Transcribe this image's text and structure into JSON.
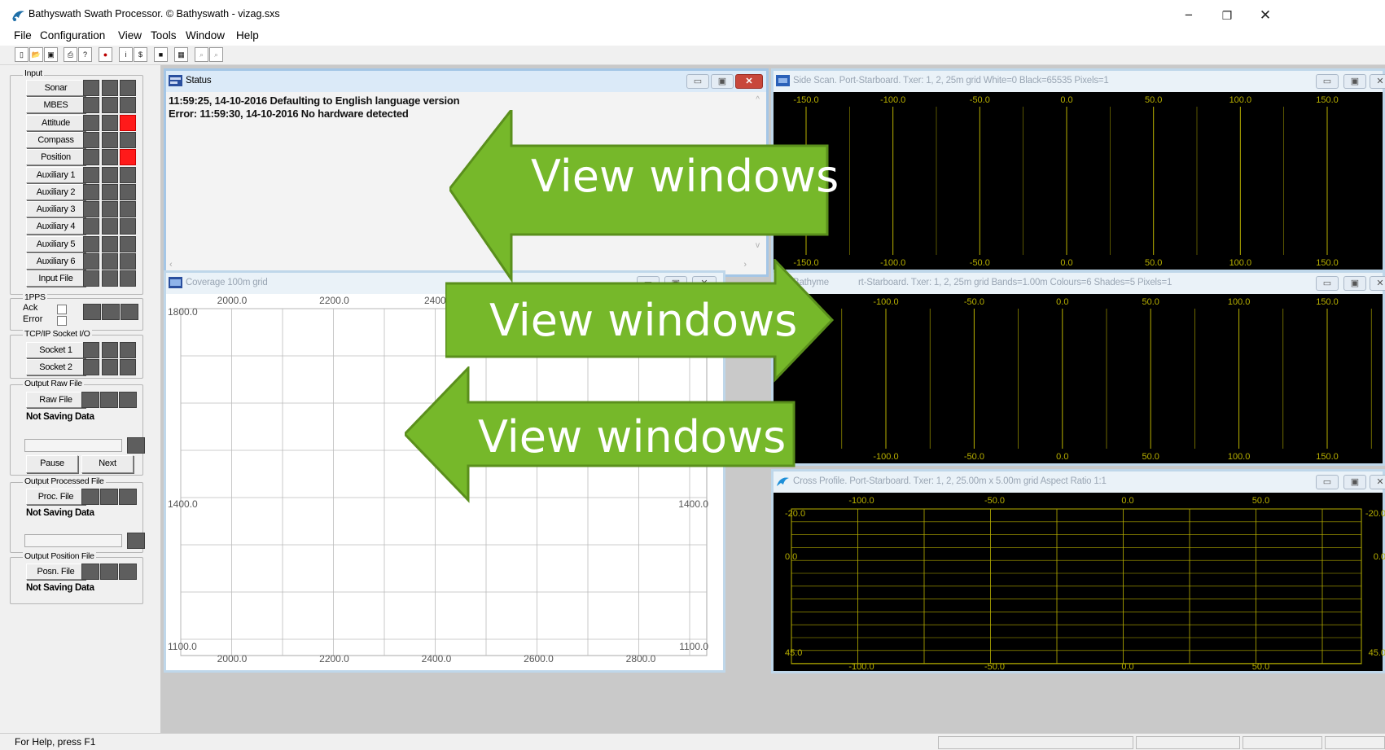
{
  "app": {
    "title": "Bathyswath Swath Processor. © Bathyswath - vizag.sxs",
    "window_controls": {
      "minimize": "−",
      "maximize": "❐",
      "close": "✕"
    }
  },
  "menu": [
    "File",
    "Configuration",
    "View",
    "Tools",
    "Window",
    "Help"
  ],
  "toolbar_icons": [
    "new-icon",
    "open-icon",
    "save-icon",
    "print-icon",
    "help-icon",
    "record-icon",
    "file-count-icon",
    "dollar-icon",
    "stop-icon",
    "chart-icon",
    "zoom-in-icon",
    "zoom-out-icon"
  ],
  "left_panel": {
    "input": {
      "label": "Input",
      "buttons": [
        "Sonar",
        "MBES",
        "Attitude",
        "Compass",
        "Position",
        "Auxiliary 1",
        "Auxiliary 2",
        "Auxiliary 3",
        "Auxiliary 4",
        "Auxiliary 5",
        "Auxiliary 6",
        "Input File"
      ],
      "red_rows": [
        2,
        4
      ]
    },
    "pps": {
      "label": "1PPS",
      "ack": "Ack",
      "error": "Error"
    },
    "tcp": {
      "label": "TCP/IP Socket I/O",
      "buttons": [
        "Socket 1",
        "Socket 2"
      ]
    },
    "raw": {
      "label": "Output Raw File",
      "button": "Raw File",
      "status": "Not Saving Data",
      "pause": "Pause",
      "next": "Next"
    },
    "processed": {
      "label": "Output Processed File",
      "button": "Proc. File",
      "status": "Not Saving Data"
    },
    "position": {
      "label": "Output Position File",
      "button": "Posn. File",
      "status": "Not Saving Data"
    }
  },
  "windows": {
    "status": {
      "title": "Status",
      "lines": [
        "11:59:25, 14-10-2016 Defaulting to English language version",
        "Error: 11:59:30, 14-10-2016 No hardware detected"
      ]
    },
    "sidescan": {
      "title": "Side Scan. Port-Starboard. Txer: 1, 2, 25m grid White=0 Black=65535 Pixels=1",
      "x_ticks": [
        "-150.0",
        "-100.0",
        "-50.0",
        "0.0",
        "50.0",
        "100.0",
        "150.0"
      ]
    },
    "coverage": {
      "title": "Coverage 100m grid",
      "x_ticks": [
        "2000.0",
        "2200.0",
        "2400.0",
        "2600.0",
        "2800.0"
      ],
      "top_x_ticks": [
        "2000.0",
        "2200.0",
        "2400."
      ],
      "y_ticks": [
        "1800.0",
        "1400.0",
        "1100.0"
      ],
      "right_y_ticks": [
        "1400.0",
        "1100.0"
      ]
    },
    "bathymetry": {
      "title_left": "Bathyme",
      "title_right": "rt-Starboard. Txer: 1, 2, 25m grid Bands=1.00m Colours=6 Shades=5 Pixels=1",
      "x_ticks": [
        "-100.0",
        "-50.0",
        "0.0",
        "50.0",
        "100.0",
        "150.0"
      ]
    },
    "cross_profile": {
      "title": "Cross Profile. Port-Starboard. Txer: 1, 2, 25.00m x 5.00m grid Aspect Ratio 1:1",
      "x_ticks": [
        "-100.0",
        "-50.0",
        "0.0",
        "50.0"
      ],
      "y_ticks": [
        "-20.0",
        "0.0",
        "45.0"
      ],
      "right_y_ticks": [
        "-20.0",
        "0.0",
        "45.0"
      ]
    }
  },
  "annotations": [
    {
      "label": "View windows",
      "direction": "left"
    },
    {
      "label": "View windows",
      "direction": "right"
    },
    {
      "label": "View windows",
      "direction": "left"
    }
  ],
  "colors": {
    "arrow_fill": "#76b82a",
    "arrow_border": "#5a8f1c",
    "indicator_red": "#ff1a1a",
    "chart_line": "#b8b000"
  },
  "statusbar": {
    "text": "For Help, press F1"
  }
}
